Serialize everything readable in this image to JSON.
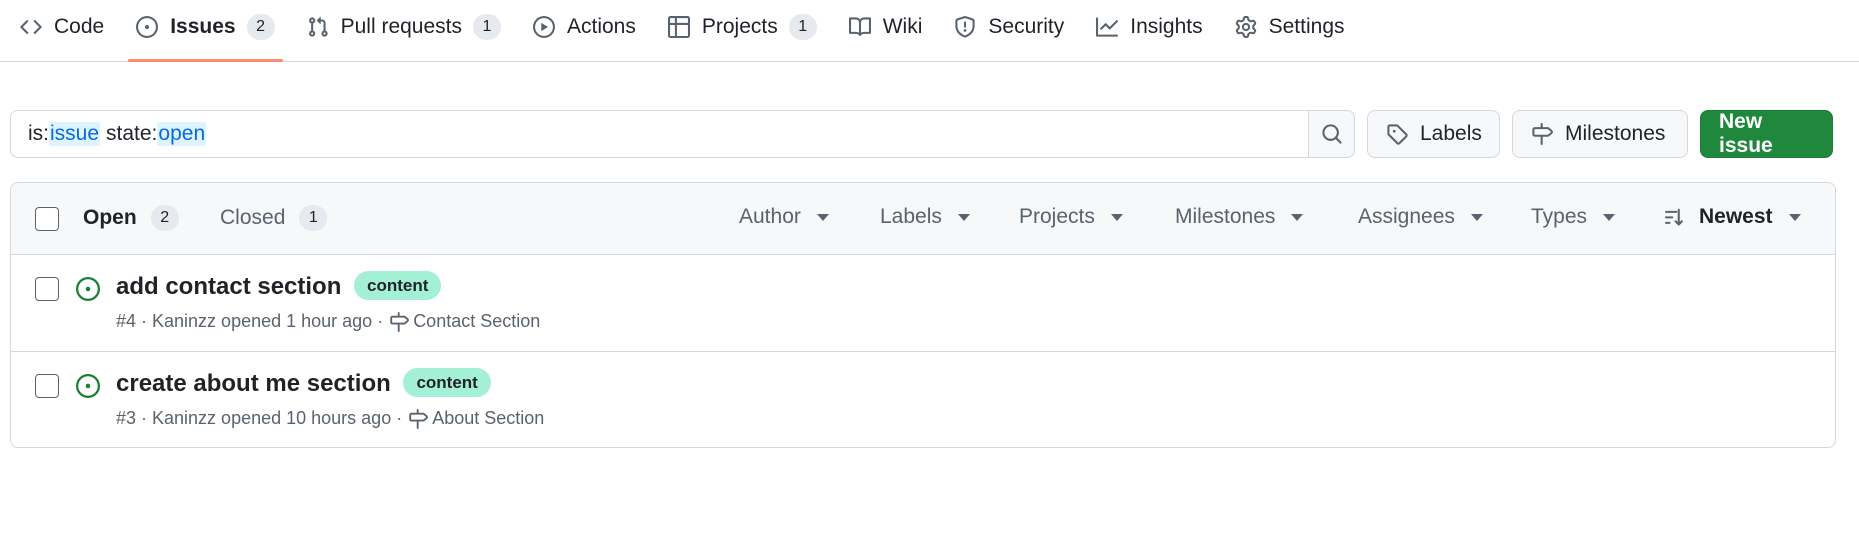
{
  "nav": {
    "items": [
      {
        "label": "Code",
        "icon": "code-icon"
      },
      {
        "label": "Issues",
        "icon": "issue-opened-icon",
        "count": "2",
        "selected": true
      },
      {
        "label": "Pull requests",
        "icon": "git-pull-request-icon",
        "count": "1"
      },
      {
        "label": "Actions",
        "icon": "play-icon"
      },
      {
        "label": "Projects",
        "icon": "table-icon",
        "count": "1"
      },
      {
        "label": "Wiki",
        "icon": "book-icon"
      },
      {
        "label": "Security",
        "icon": "shield-icon"
      },
      {
        "label": "Insights",
        "icon": "graph-icon"
      },
      {
        "label": "Settings",
        "icon": "gear-icon"
      }
    ]
  },
  "search": {
    "qualifier1": "is:",
    "value1": "issue",
    "qualifier2": "state:",
    "value2": "open"
  },
  "actions": {
    "labels": "Labels",
    "milestones": "Milestones",
    "new_issue": "New issue"
  },
  "list": {
    "open_label": "Open",
    "open_count": "2",
    "closed_label": "Closed",
    "closed_count": "1",
    "filters": [
      "Author",
      "Labels",
      "Projects",
      "Milestones",
      "Assignees",
      "Types"
    ],
    "sort": "Newest",
    "issues": [
      {
        "title": "add contact section",
        "label": "content",
        "meta": "#4 · Kaninzz opened 1 hour ago ·",
        "milestone": "Contact Section"
      },
      {
        "title": "create about me section",
        "label": "content",
        "meta": "#3 · Kaninzz opened 10 hours ago ·",
        "milestone": "About Section"
      }
    ]
  },
  "colors": {
    "accent_underline": "#fd8c73",
    "primary_button": "#1f883d",
    "open_status": "#1a7f37",
    "label_bg": "#a3f0d4",
    "link": "#0969da"
  }
}
